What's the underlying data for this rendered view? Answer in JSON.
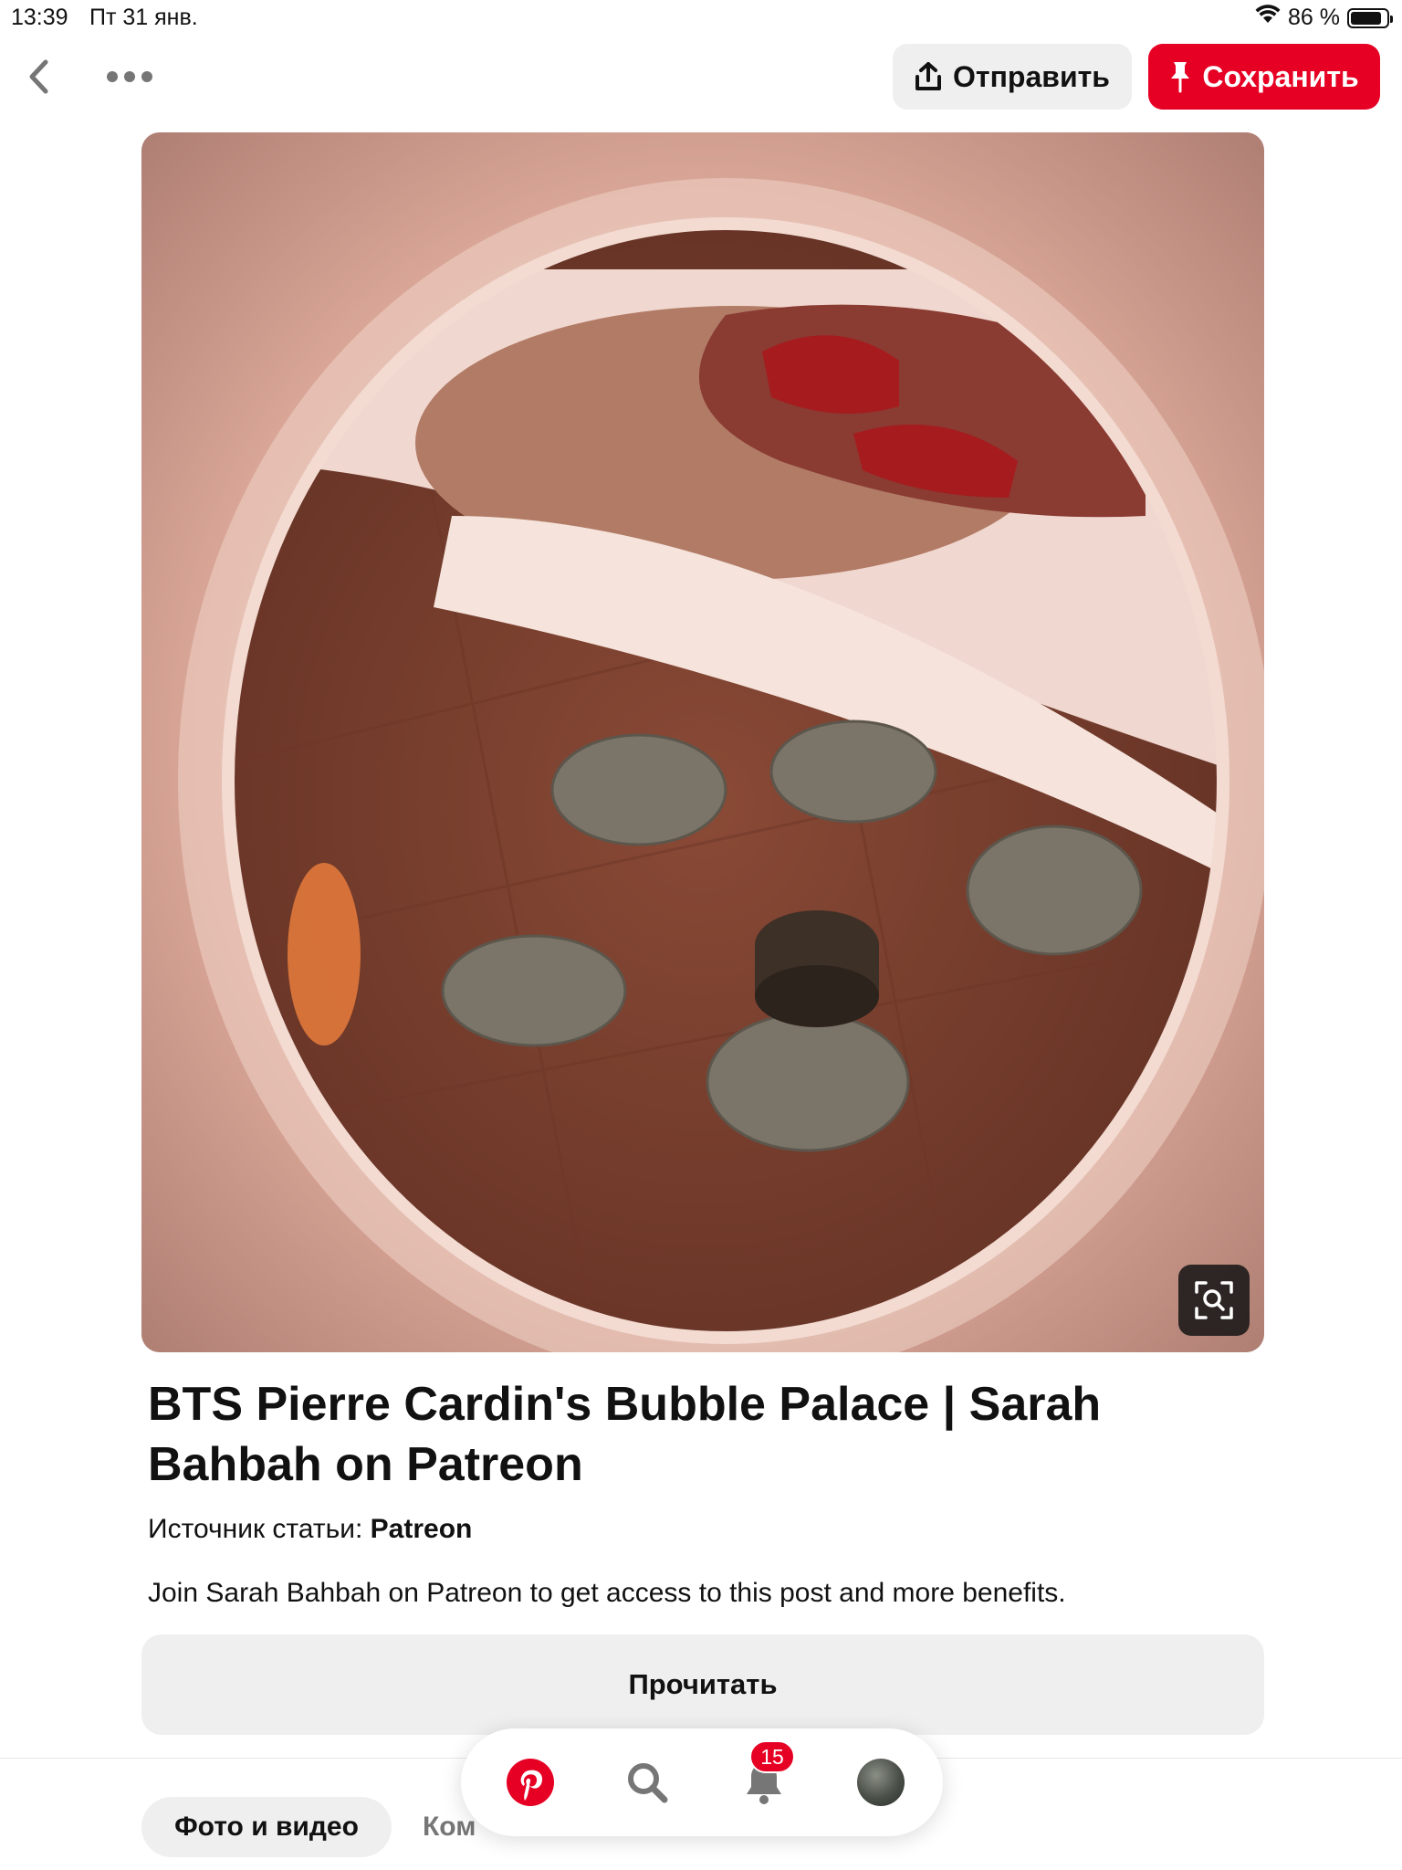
{
  "status_bar": {
    "time": "13:39",
    "date": "Пт 31 янв.",
    "battery_text": "86 %",
    "battery_level": 0.86
  },
  "toolbar": {
    "back_icon": "chevron-left-icon",
    "more_icon": "more-horizontal-icon",
    "share_label": "Отправить",
    "share_icon": "upload-icon",
    "save_label": "Сохранить",
    "save_icon": "pushpin-icon",
    "save_color": "#e60023"
  },
  "pin": {
    "image_icon": "visual-search-icon",
    "title": "BTS Pierre Cardin's Bubble Palace | Sarah Bahbah on Patreon",
    "source_label": "Источник статьи:",
    "source_name": "Patreon",
    "description": "Join Sarah Bahbah on Patreon to get access to this post and more benefits.",
    "read_button": "Прочитать"
  },
  "tabs": [
    {
      "label": "Фото и видео",
      "active": true
    },
    {
      "label": "Ком",
      "active": false
    }
  ],
  "bottom_nav": {
    "items": [
      "pinterest-home-icon",
      "search-icon",
      "bell-icon",
      "avatar"
    ],
    "notification_count": "15"
  }
}
